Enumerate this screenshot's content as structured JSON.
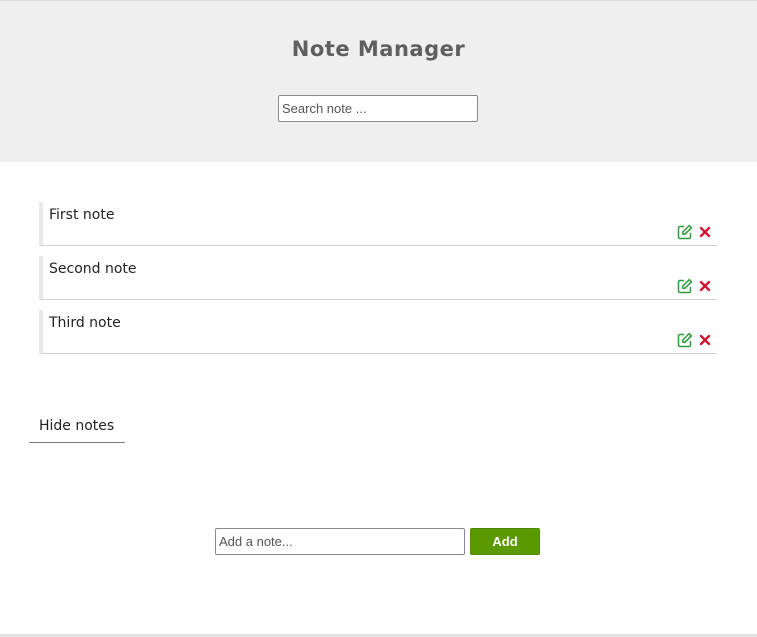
{
  "header": {
    "title": "Note Manager",
    "search_placeholder": "Search note ..."
  },
  "notes": [
    {
      "text": "First note"
    },
    {
      "text": "Second note"
    },
    {
      "text": "Third note"
    }
  ],
  "icons": {
    "edit": "edit-icon",
    "delete": "close-icon"
  },
  "colors": {
    "header_background": "#efefef",
    "edit_icon": "#2e9d3a",
    "delete_icon": "#d6102e",
    "add_button": "#5a9a00"
  },
  "toggle": {
    "label": "Hide notes"
  },
  "add_form": {
    "placeholder": "Add a note...",
    "button_label": "Add"
  }
}
